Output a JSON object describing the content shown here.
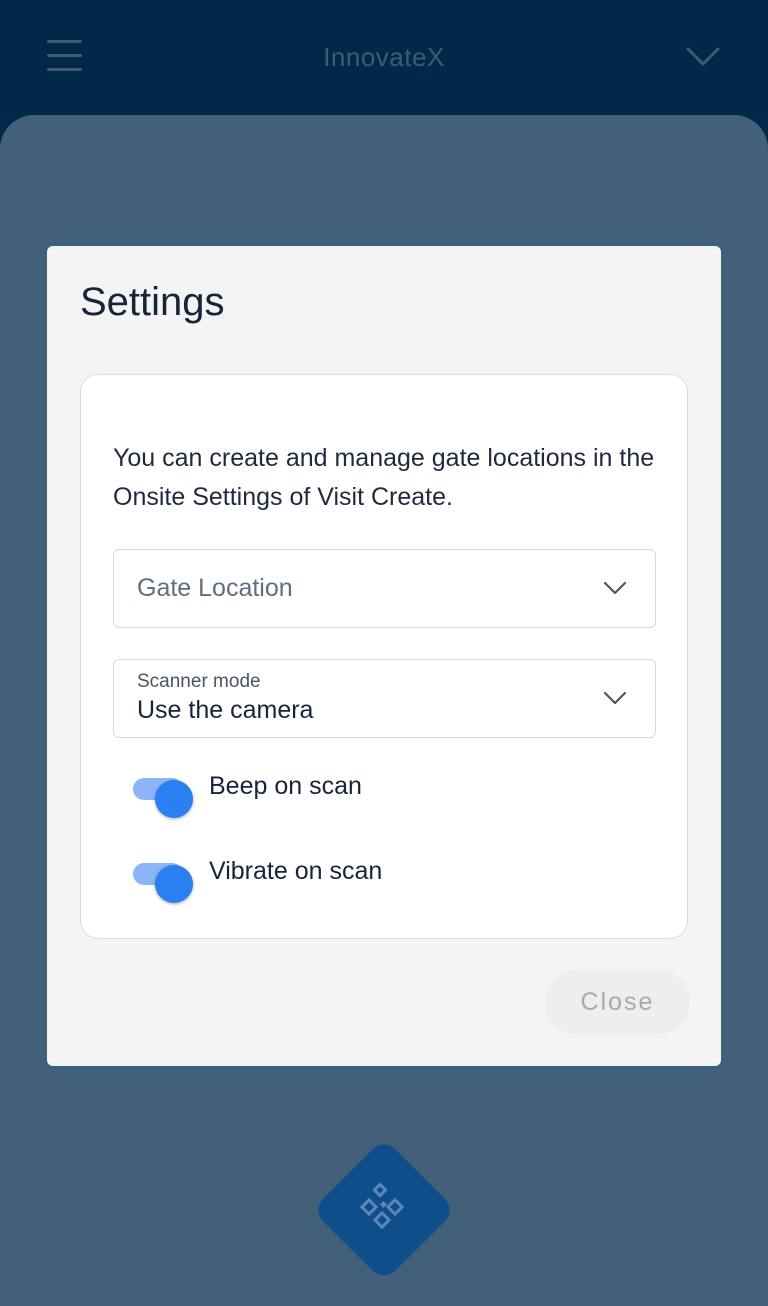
{
  "header": {
    "app_title": "InnovateX",
    "menu_icon": "hamburger-menu-icon",
    "dropdown_icon": "chevron-down-icon"
  },
  "dialog": {
    "title": "Settings",
    "info_text": "You can create and manage gate locations in the Onsite Settings of Visit Create.",
    "gate_location": {
      "placeholder": "Gate Location"
    },
    "scanner_mode": {
      "label": "Scanner mode",
      "value": "Use the camera"
    },
    "toggles": [
      {
        "label": "Beep on scan",
        "on": true
      },
      {
        "label": "Vibrate on scan",
        "on": true
      }
    ],
    "close_label": "Close"
  },
  "colors": {
    "header_bg": "#002949",
    "overlay_bg": "#43607a",
    "toggle_on": "#2a7ff2",
    "fab_bg": "#0f4e8c"
  },
  "fab": {
    "icon": "qr-scan-icon"
  }
}
